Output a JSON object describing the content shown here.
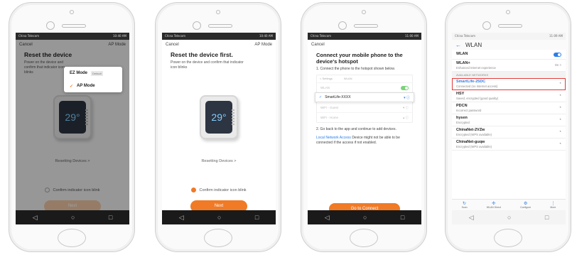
{
  "status": {
    "carrier": "China Telecom",
    "time_1": "10:40 AM",
    "time_2": "10:40 AM",
    "time_3": "11:00 AM",
    "time_4": "11:09 AM",
    "battery": "91%",
    "battery_4": "88%"
  },
  "screen1": {
    "cancel": "Cancel",
    "mode_selector": "AP Mode",
    "title": "Reset the device",
    "subtitle": "Power on the device and confirm that indicator icon blinks",
    "menu": [
      {
        "label": "EZ Mode",
        "tag": "Default",
        "checked": false
      },
      {
        "label": "AP Mode",
        "tag": "",
        "checked": true
      }
    ],
    "lcd": "29°",
    "resetting_link": "Resetting Devices >",
    "confirm": "Confirm indicator icon blink",
    "next": "Next"
  },
  "screen2": {
    "cancel": "Cancel",
    "mode_selector": "AP Mode",
    "title": "Reset the device first.",
    "subtitle": "Power on the device and confirm that indicator icon blinks",
    "lcd": "29°",
    "resetting_link": "Resetting Devices >",
    "confirm": "Confirm indicator icon blink",
    "next": "Next"
  },
  "screen3": {
    "cancel": "Cancel",
    "title": "Connect your mobile phone to the device's hotspot",
    "step1": "1. Connect the phone to the hotspot shown below.",
    "mini_back": "< Settings",
    "mini_title": "WLAN",
    "mini_wlan": "WLAN",
    "mini_selected": "SmartLife-XXXX",
    "mini_other_1": "WiFi - Guest",
    "mini_other_2": "WiFi - Home",
    "step2": "2. Go back to the app and continue to add devices.",
    "local_access": "Local Network Access",
    "note": "Device might not be able to be connected if the access if not enabled.",
    "go": "Go to Connect"
  },
  "screen4": {
    "title": "WLAN",
    "wlan_label": "WLAN",
    "wlan_plus": "WLAN+",
    "wlan_plus_sub": "Enhanced Internet experience",
    "wlan_plus_val": "On >",
    "section": "AVAILABLE NETWORKS",
    "networks": [
      {
        "name": "SmartLife-25DC",
        "sub": "Connected (no Internet access)"
      },
      {
        "name": "HSY",
        "sub": "Saved, encrypted (good quality)"
      },
      {
        "name": "PDCN",
        "sub": "Incorrect password"
      },
      {
        "name": "hysen",
        "sub": "Encrypted"
      },
      {
        "name": "ChinaNet-2VZw",
        "sub": "Encrypted (WPS available)"
      },
      {
        "name": "ChinaNet-guqw",
        "sub": "Encrypted (WPS available)"
      }
    ],
    "toolbar": [
      "Scan",
      "WLAN Direct",
      "Configure",
      "More"
    ]
  }
}
